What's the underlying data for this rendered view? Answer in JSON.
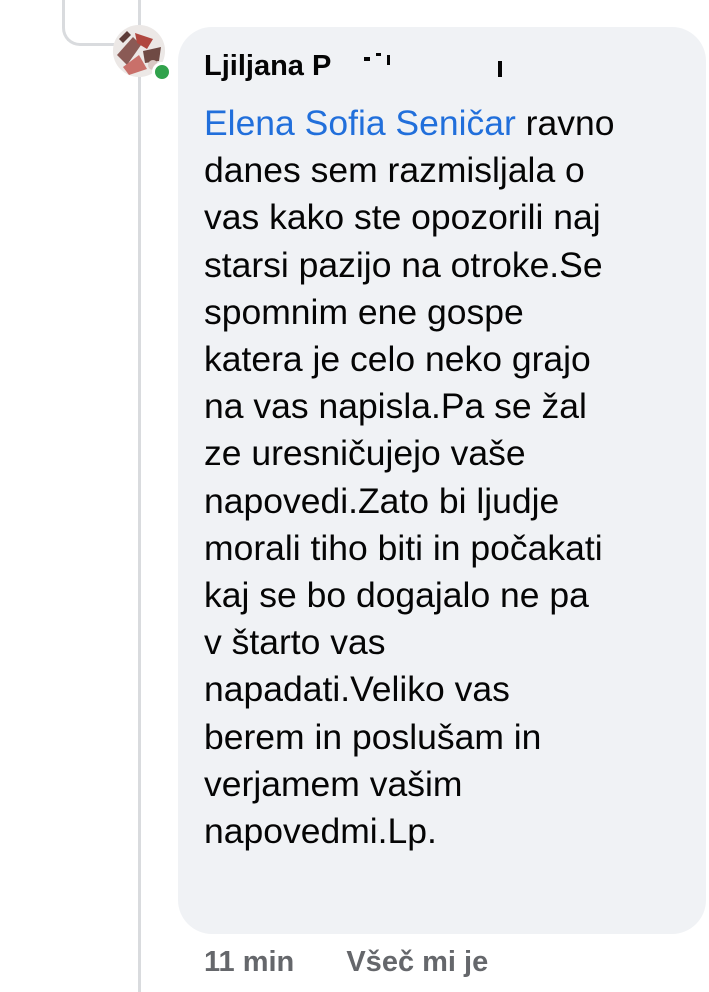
{
  "comment": {
    "author": "Ljiljana P",
    "mention": "Elena Sofia Seničar",
    "lines": [
      " ravno",
      "danes sem razmisljala o",
      "vas kako ste opozorili naj",
      "starsi pazijo na otroke.Se",
      "spomnim ene gospe",
      "katera je celo neko grajo",
      "na vas napisla.Pa se žal",
      "ze uresničujejo vaše",
      "napovedi.Zato bi ljudje",
      "morali tiho biti in počakati",
      "kaj se bo dogajalo ne pa",
      "v štarto vas",
      "napadati.Veliko vas",
      "berem in poslušam in",
      "verjamem vašim",
      "napovedmi.Lp."
    ],
    "time": "11 min",
    "like_label": "Všeč mi je"
  },
  "colors": {
    "bubble": "#f0f2f5",
    "mention": "#216fdb",
    "text": "#050505",
    "meta": "#65676b",
    "online": "#31a24c"
  },
  "icons": {
    "avatar": "profile-photo",
    "online_indicator": "online-status-dot"
  }
}
